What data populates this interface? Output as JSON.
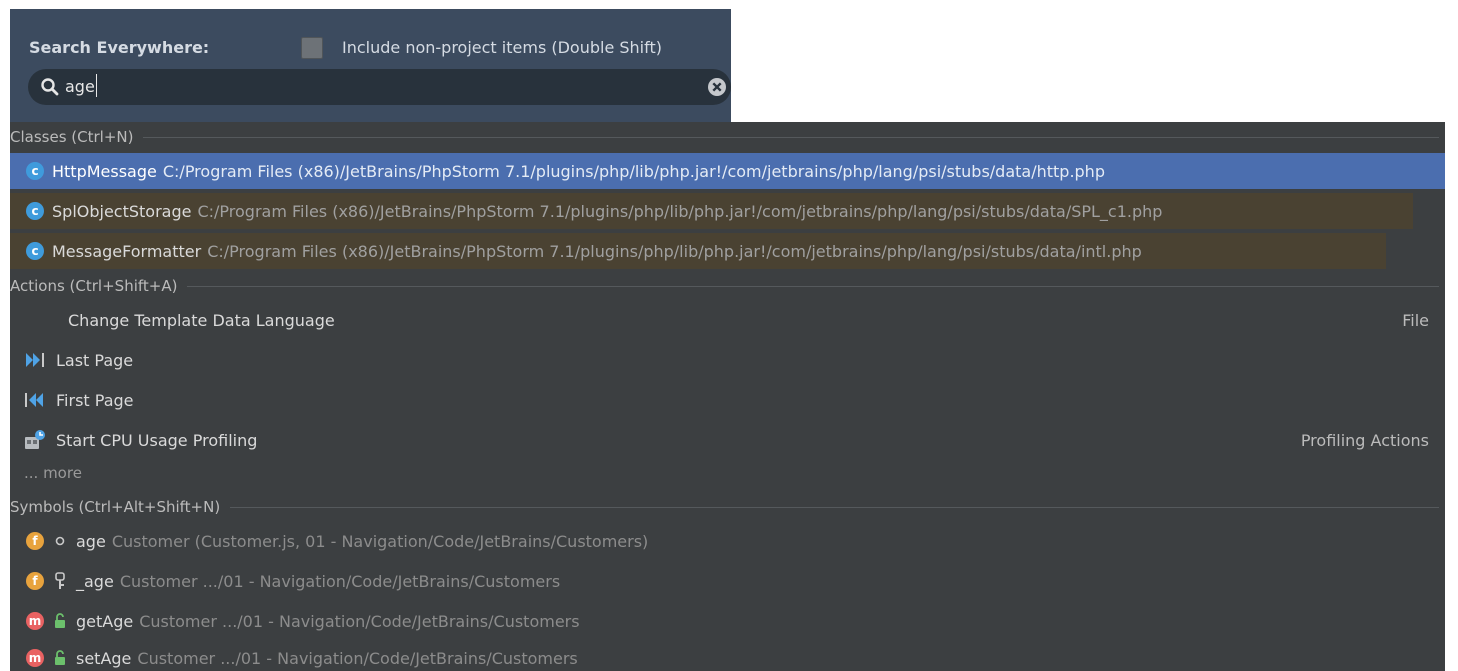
{
  "header": {
    "title": "Search Everywhere:",
    "include_label": "Include non-project items (Double Shift)",
    "include_checked": false,
    "query": "age"
  },
  "sections": {
    "classes": {
      "title": "Classes (Ctrl+N)",
      "items": [
        {
          "name": "HttpMessage",
          "path": "C:/Program Files (x86)/JetBrains/PhpStorm 7.1/plugins/php/lib/php.jar!/com/jetbrains/php/lang/psi/stubs/data/http.php",
          "badge": "c",
          "state": "selected"
        },
        {
          "name": "SplObjectStorage",
          "path": "C:/Program Files (x86)/JetBrains/PhpStorm 7.1/plugins/php/lib/php.jar!/com/jetbrains/php/lang/psi/stubs/data/SPL_c1.php",
          "badge": "c",
          "state": "non-project"
        },
        {
          "name": "MessageFormatter",
          "path": "C:/Program Files (x86)/JetBrains/PhpStorm 7.1/plugins/php/lib/php.jar!/com/jetbrains/php/lang/psi/stubs/data/intl.php",
          "badge": "c",
          "state": "non-project"
        }
      ]
    },
    "actions": {
      "title": "Actions (Ctrl+Shift+A)",
      "items": [
        {
          "name": "Change Template Data Language",
          "group": "File",
          "icon": "none"
        },
        {
          "name": "Last Page",
          "group": "",
          "icon": "last-page-icon"
        },
        {
          "name": "First Page",
          "group": "",
          "icon": "first-page-icon"
        },
        {
          "name": "Start CPU Usage Profiling",
          "group": "Profiling Actions",
          "icon": "cpu-profiling-icon"
        }
      ],
      "more": "... more"
    },
    "symbols": {
      "title": "Symbols (Ctrl+Alt+Shift+N)",
      "items": [
        {
          "name": "age",
          "location": "Customer (Customer.js, 01 - Navigation/Code/JetBrains/Customers)",
          "badge": "f",
          "visibility": "circle-icon"
        },
        {
          "name": "_age",
          "location": "Customer .../01 - Navigation/Code/JetBrains/Customers",
          "badge": "f",
          "visibility": "private-key-icon"
        },
        {
          "name": "getAge",
          "location": "Customer .../01 - Navigation/Code/JetBrains/Customers",
          "badge": "m",
          "visibility": "public-lock-icon"
        },
        {
          "name": "setAge",
          "location": "Customer .../01 - Navigation/Code/JetBrains/Customers",
          "badge": "m",
          "visibility": "public-lock-icon"
        }
      ]
    }
  },
  "colors": {
    "header_bg": "#3c4b5f",
    "list_bg": "#3c3f41",
    "selection": "#4b6eaf",
    "non_project_bg": "#4a4232",
    "class_badge": "#3f9bdc",
    "field_badge": "#e8a33d",
    "method_badge": "#e96262"
  }
}
